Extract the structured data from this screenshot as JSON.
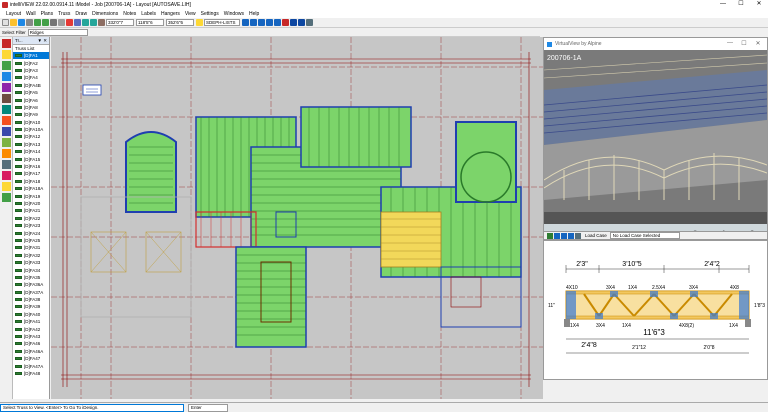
{
  "window": {
    "title": "intelliVIEW 22.02.00.0914.11 iModel - Job [200706-1A] - Layout [AUTOSAVE.LIH]",
    "min": "—",
    "max": "☐",
    "close": "✕"
  },
  "menu": [
    "Layout",
    "Wall",
    "Plans",
    "Truss",
    "Draw",
    "Dimensions",
    "Notes",
    "Labels",
    "Hangers",
    "View",
    "Settings",
    "Windows",
    "Help"
  ],
  "toolbar": {
    "coords": "332'0\"7",
    "coords2": "118'5\"6",
    "coords3": "352'6\"6",
    "joists_label": "SDEPH-LISTS"
  },
  "filter": {
    "label": "Select Filter",
    "value": "Ridges"
  },
  "trusslist": {
    "header": "Tr...",
    "header_icons": "▼ ✕",
    "title": "Truss List",
    "items": [
      "[D]FA1",
      "[D]FA2",
      "[D]FA3",
      "[D]FA4",
      "[D]FA4B",
      "[D]FA5",
      "[D]FA6",
      "[D]FA8",
      "[D]FA9",
      "[D]FA10",
      "[D]FA10A",
      "[D]FA12",
      "[D]FA13",
      "[D]FA14",
      "[D]FA15",
      "[D]FA16",
      "[D]FA17",
      "[D]FA18",
      "[D]FA18A",
      "[D]FA19",
      "[D]FA20",
      "[D]FA21",
      "[D]FA22",
      "[D]FA23",
      "[D]FA24",
      "[D]FA25",
      "[D]FA31",
      "[D]FA32",
      "[D]FA33",
      "[D]FA34",
      "[D]FA35",
      "[D]FA36A",
      "[D]FA37A",
      "[D]FA38",
      "[D]FA39",
      "[D]FA40",
      "[D]FA41",
      "[D]FA42",
      "[D]FA43",
      "[D]FA46",
      "[D]FA46A",
      "[D]FA47",
      "[D]FA47A",
      "[D]FA48"
    ],
    "selected_index": 0
  },
  "virtualview": {
    "title": "VirtualView by Alpine",
    "label": "200706-1A",
    "min": "—",
    "max": "☐",
    "close": "✕",
    "nav": [
      "⌂",
      "↑",
      "⌄",
      "‹",
      "›",
      "◉",
      "⌕",
      "⊕"
    ]
  },
  "loadcase": {
    "label": "Load Case",
    "value": "No Load Case Selected"
  },
  "truss_view": {
    "dims_top": [
      "2'3\"",
      "3'10\"5",
      "2'4\"2"
    ],
    "plates": [
      "4X10",
      "3X4",
      "1X4",
      "2.5X4",
      "3X4",
      "4X8"
    ],
    "plates_bottom": [
      "1X4",
      "3X4",
      "1X4",
      "4X8(2)",
      "1X4"
    ],
    "span": "11'6\"3",
    "dims_bottom": [
      "2'4\"8",
      "2'1\"12",
      "2'0\"8"
    ],
    "heights": [
      "11\"",
      "1'8\"3"
    ]
  },
  "status": {
    "prompt": "Select Truss to View. <Enter> To Go To iDesign.",
    "field": "Enter"
  }
}
